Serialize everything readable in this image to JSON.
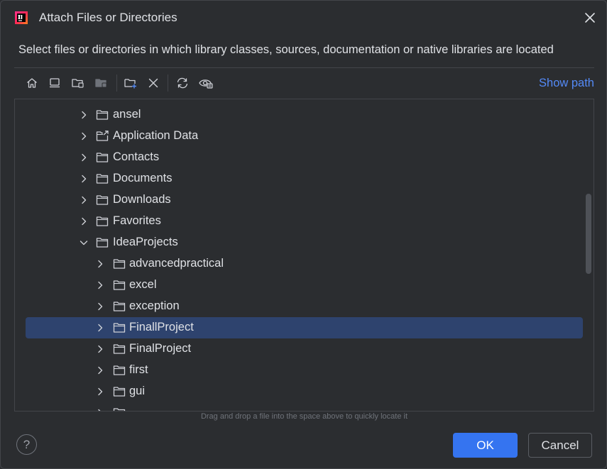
{
  "window": {
    "title": "Attach Files or Directories",
    "app_icon": "intellij-idea-icon",
    "close_icon": "close-icon"
  },
  "description": "Select files or directories in which library classes, sources, documentation or native libraries are located",
  "toolbar": {
    "icons": [
      "home-icon",
      "desktop-icon",
      "project-folder-icon",
      "module-folder-icon",
      "new-folder-icon",
      "delete-icon",
      "refresh-icon",
      "show-hidden-icon"
    ],
    "show_path_label": "Show path"
  },
  "tree": {
    "items": [
      {
        "label": "ansel",
        "depth": 1,
        "expanded": false,
        "icon": "folder-icon"
      },
      {
        "label": "Application Data",
        "depth": 1,
        "expanded": false,
        "icon": "folder-link-icon"
      },
      {
        "label": "Contacts",
        "depth": 1,
        "expanded": false,
        "icon": "folder-icon"
      },
      {
        "label": "Documents",
        "depth": 1,
        "expanded": false,
        "icon": "folder-icon"
      },
      {
        "label": "Downloads",
        "depth": 1,
        "expanded": false,
        "icon": "folder-icon"
      },
      {
        "label": "Favorites",
        "depth": 1,
        "expanded": false,
        "icon": "folder-icon"
      },
      {
        "label": "IdeaProjects",
        "depth": 1,
        "expanded": true,
        "icon": "folder-icon"
      },
      {
        "label": "advancedpractical",
        "depth": 2,
        "expanded": false,
        "icon": "folder-icon"
      },
      {
        "label": "excel",
        "depth": 2,
        "expanded": false,
        "icon": "folder-icon"
      },
      {
        "label": "exception",
        "depth": 2,
        "expanded": false,
        "icon": "folder-icon"
      },
      {
        "label": "FinallProject",
        "depth": 2,
        "expanded": false,
        "icon": "folder-icon",
        "selected": true
      },
      {
        "label": "FinalProject",
        "depth": 2,
        "expanded": false,
        "icon": "folder-icon"
      },
      {
        "label": "first",
        "depth": 2,
        "expanded": false,
        "icon": "folder-icon"
      },
      {
        "label": "gui",
        "depth": 2,
        "expanded": false,
        "icon": "folder-icon"
      }
    ]
  },
  "hint": "Drag and drop a file into the space above to quickly locate it",
  "footer": {
    "help_label": "?",
    "ok_label": "OK",
    "cancel_label": "Cancel"
  },
  "colors": {
    "background": "#2b2d30",
    "selection": "#2e436e",
    "accent": "#3574f0",
    "link": "#548af7"
  }
}
